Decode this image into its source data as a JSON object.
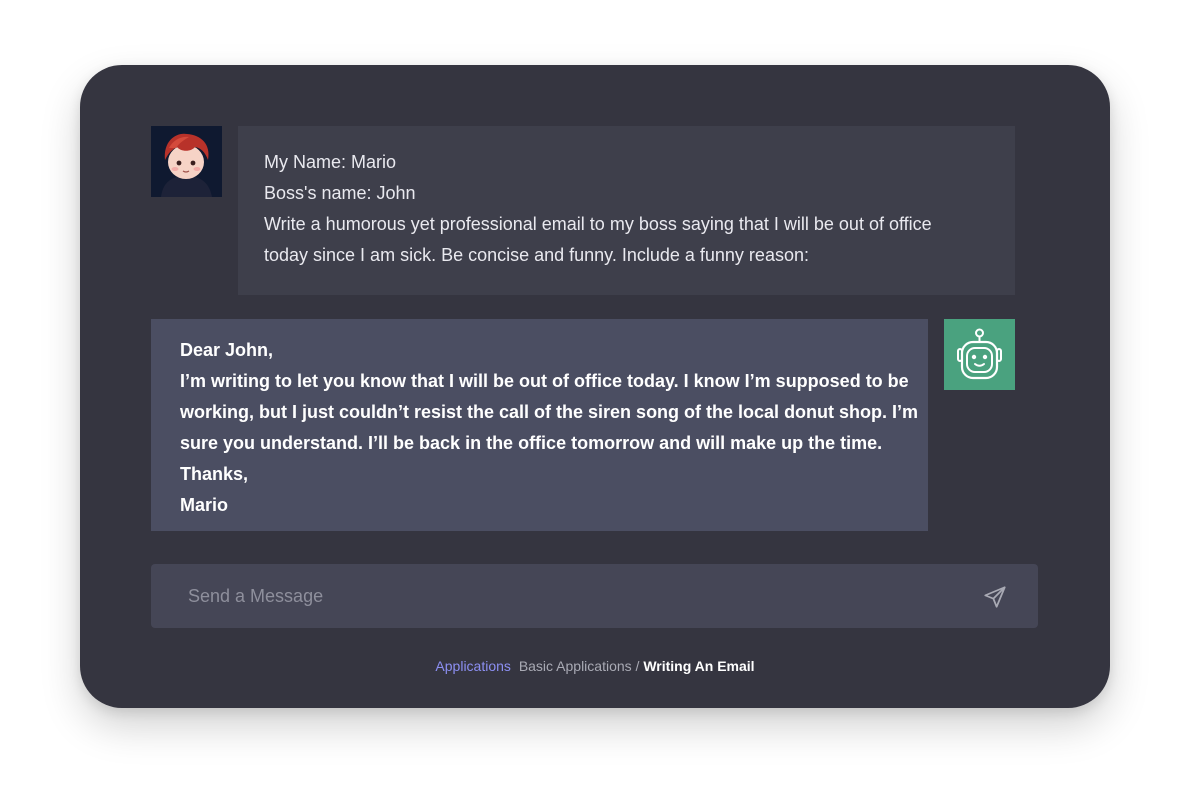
{
  "conversation": {
    "user_message": {
      "lines": [
        "My Name: Mario",
        "Boss's name: John",
        "Write a humorous yet professional email to my boss saying that I will be out of office",
        "today since I am sick. Be concise and funny. Include a funny reason:"
      ]
    },
    "bot_message": {
      "lines": [
        "Dear John,",
        "I’m writing to let you know that I will be out of office today. I know I’m supposed to be",
        "working, but I just couldn’t resist the call of the siren song of the local donut shop. I’m",
        "sure you understand. I’ll be back in the office tomorrow and will make up the time.",
        "Thanks,",
        "Mario"
      ]
    }
  },
  "composer": {
    "placeholder": "Send a Message",
    "value": "",
    "send_icon": "send-icon"
  },
  "breadcrumb": {
    "root": "Applications",
    "section": "Basic Applications",
    "separator": "/",
    "current": "Writing An Email"
  },
  "colors": {
    "card_background": "#353540",
    "user_bubble": "#3e3f4b",
    "bot_bubble": "#4b4e62",
    "bot_avatar": "#4aa27f",
    "accent_link": "#8c8ff2"
  }
}
